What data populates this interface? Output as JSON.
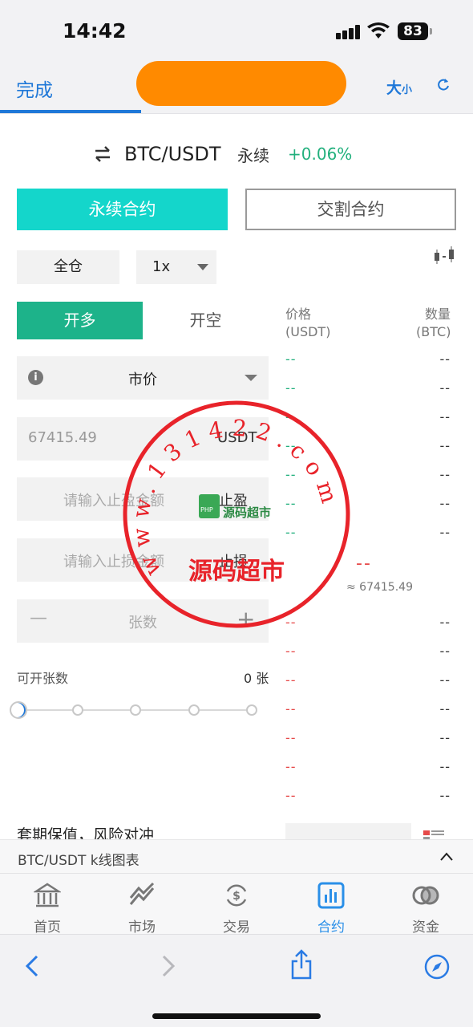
{
  "status_bar": {
    "time": "14:42",
    "battery": "83"
  },
  "top_bar": {
    "done_label": "完成",
    "size_label": "大",
    "size_label_small": "小"
  },
  "pair_header": {
    "pair": "BTC/USDT",
    "contract_type": "永续",
    "change": "+0.06%"
  },
  "contract_tabs": {
    "perpetual": "永续合约",
    "delivery": "交割合约"
  },
  "margin": {
    "mode": "全仓",
    "leverage": "1x"
  },
  "side_tabs": {
    "long": "开多",
    "short": "开空"
  },
  "order_form": {
    "order_type": "市价",
    "price_value": "67415.49",
    "price_unit": "USDT",
    "take_profit_placeholder": "请输入止盈金额",
    "take_profit_label": "止盈",
    "stop_loss_placeholder": "请输入止损金额",
    "stop_loss_label": "止损",
    "quantity_placeholder": "张数",
    "minus": "—",
    "plus": "+"
  },
  "available": {
    "label": "可开张数",
    "value": "0 张"
  },
  "hedge": {
    "label": "套期保值，风险对冲"
  },
  "order_book": {
    "price_header": "价格",
    "price_unit": "(USDT)",
    "qty_header": "数量",
    "qty_unit": "(BTC)",
    "bids": [
      {
        "price": "--",
        "qty": "--"
      },
      {
        "price": "--",
        "qty": "--"
      },
      {
        "price": "--",
        "qty": "--"
      },
      {
        "price": "--",
        "qty": "--"
      },
      {
        "price": "--",
        "qty": "--"
      },
      {
        "price": "--",
        "qty": "--"
      },
      {
        "price": "--",
        "qty": "--"
      }
    ],
    "mid_price": "--",
    "mid_ref": "≈ 67415.49",
    "asks": [
      {
        "price": "--",
        "qty": "--"
      },
      {
        "price": "--",
        "qty": "--"
      },
      {
        "price": "--",
        "qty": "--"
      },
      {
        "price": "--",
        "qty": "--"
      },
      {
        "price": "--",
        "qty": "--"
      },
      {
        "price": "--",
        "qty": "--"
      },
      {
        "price": "--",
        "qty": "--"
      }
    ]
  },
  "watermark": {
    "ring_text": "www.131422.com",
    "center_text": "源码超市",
    "logo_text": "源码超市",
    "logo_badge": "PHP"
  },
  "kline_bar": {
    "label": "BTC/USDT k线图表"
  },
  "bottom_nav": [
    {
      "label": "首页",
      "icon": "home-icon"
    },
    {
      "label": "市场",
      "icon": "market-chart-icon"
    },
    {
      "label": "交易",
      "icon": "exchange-icon"
    },
    {
      "label": "合约",
      "icon": "contract-icon"
    },
    {
      "label": "资金",
      "icon": "funds-icon"
    }
  ],
  "colors": {
    "accent": "#1f78d8",
    "teal": "#14d6cb",
    "long_green": "#1db38a",
    "up_green": "#22b07d",
    "down_red": "#e64a4a",
    "redaction": "#ff8a00"
  }
}
